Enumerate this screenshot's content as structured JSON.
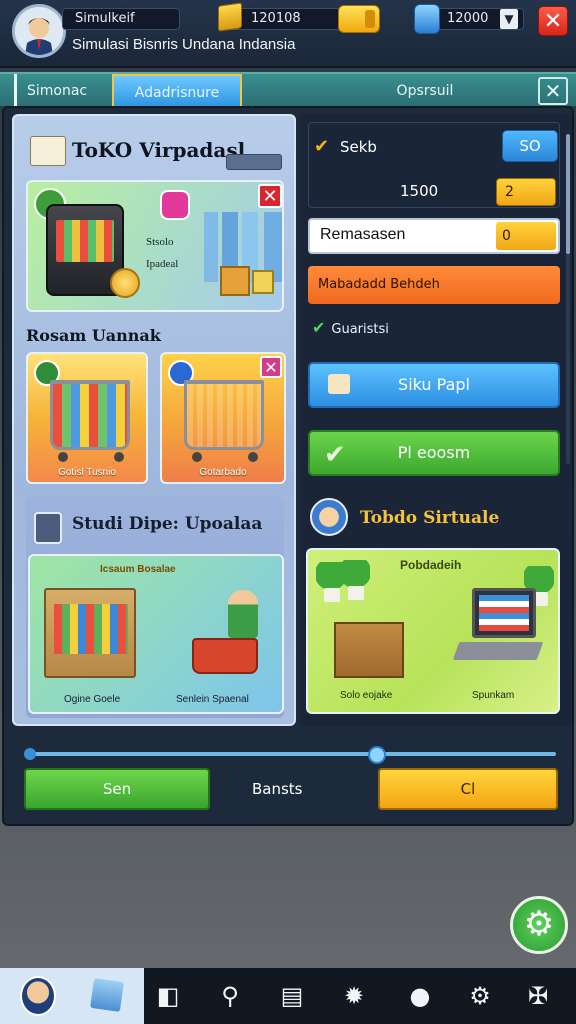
{
  "header": {
    "player_name": "Simulkeif",
    "title": "Simulasi Bisnris Undana Indansia",
    "coins": "120108",
    "gems": "12000"
  },
  "tabs": [
    {
      "label": "Simonac"
    },
    {
      "label": "Adadrisnure"
    },
    {
      "label": "Opsrsuil"
    }
  ],
  "left": {
    "shop_title": "ToKO Virpadasl",
    "card1_text_a": "Stsolo",
    "card1_text_b": "Ipadeal",
    "section2_title": "Rosam Uannak",
    "cart_a_label": "Gotisl Tusnio",
    "cart_b_label": "Gotarbado",
    "studi_title": "Studi Dipe: Upoalaa",
    "studi_banner": "Icsaum Bosalae",
    "studi_label_a": "Ogine Goele",
    "studi_label_b": "Senlein Spaenal"
  },
  "right": {
    "seko_label": "Sekb",
    "seko_value": "SO",
    "amount": "1500",
    "amount_pill": "2",
    "input_label": "Remasasen",
    "input_value": "0",
    "orange_label": "Mabadadd Behdeh",
    "guarantee": "Guaristsi",
    "blue_button": "Siku Papl",
    "green_button": "Pl eoosm",
    "virtual_title": "Tobdo Sirtuale",
    "virtual_banner": "Pobdadeih",
    "virtual_label_a": "Solo eojake",
    "virtual_label_b": "Spunkam"
  },
  "footer": {
    "left_button": "Sen",
    "middle_text": "Bansts",
    "right_button": "Cl",
    "slider_level": 0.66
  },
  "colors": {
    "accent_green": "#3ea830",
    "accent_yellow": "#f2a616",
    "accent_blue": "#2c8fe3",
    "accent_orange": "#f06a1e",
    "teal_tabbar": "#2b6f75"
  },
  "icons": {
    "settings": "gear-icon",
    "close": "close-icon",
    "coins": "gold-bar-icon",
    "gems": "gem-icon"
  }
}
